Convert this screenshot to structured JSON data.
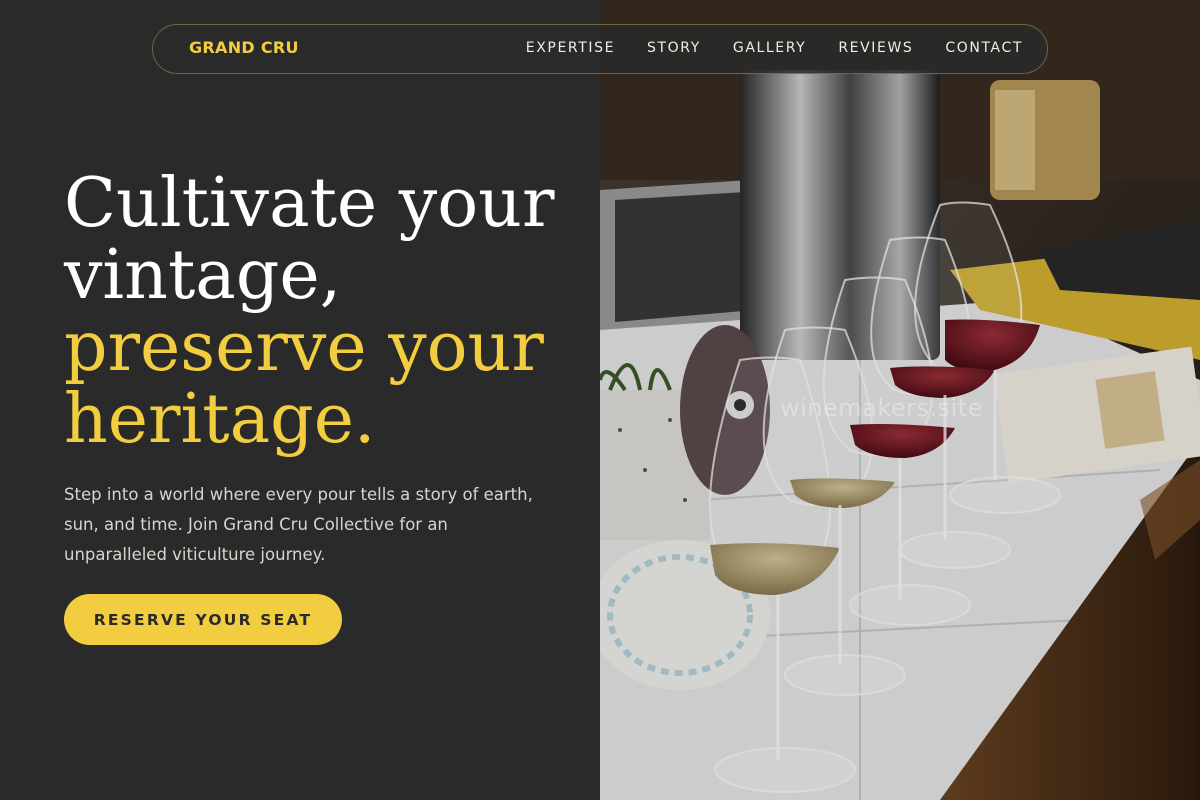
{
  "nav": {
    "brand": "GRAND CRU",
    "links": [
      "EXPERTISE",
      "STORY",
      "GALLERY",
      "REVIEWS",
      "CONTACT"
    ]
  },
  "hero": {
    "title_line1": "Cultivate your",
    "title_line2": "vintage,",
    "title_line3": "preserve your",
    "title_line4": "heritage.",
    "subtitle": "Step into a world where every pour tells a story of earth, sun, and time. Join Grand Cru Collective for an unparalleled viticulture journey.",
    "cta_label": "RESERVE YOUR SEAT"
  },
  "photo": {
    "description": "wine tasting glasses on tiled table",
    "watermark": "winemakers.site"
  },
  "colors": {
    "background": "#2a2a2a",
    "accent": "#f2cd3f",
    "text": "#ffffff"
  }
}
